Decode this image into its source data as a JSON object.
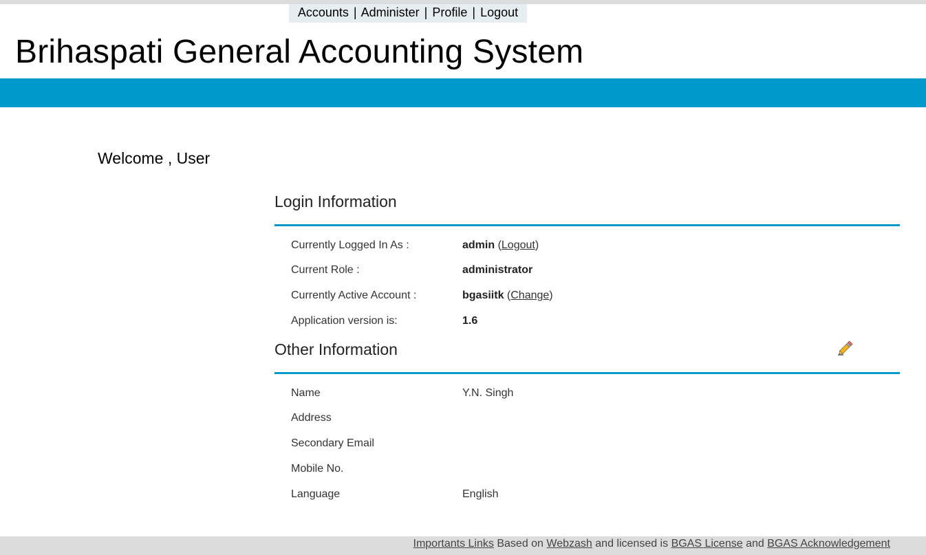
{
  "nav": {
    "items": [
      {
        "label": "Accounts"
      },
      {
        "label": "Administer"
      },
      {
        "label": "Profile"
      },
      {
        "label": "Logout"
      }
    ],
    "separator": "|"
  },
  "header": {
    "title": "Brihaspati General Accounting System",
    "bar_color": "#0099cc"
  },
  "welcome": "Welcome , User",
  "login_info": {
    "title": "Login Information",
    "logged_in_label": "Currently Logged In As :",
    "logged_in_user": "admin",
    "logout_link": "Logout",
    "role_label": "Current Role :",
    "role_value": "administrator",
    "account_label": "Currently Active Account :",
    "account_value": "bgasiitk",
    "change_link": "Change",
    "version_label": "Application version is:",
    "version_value": "1.6"
  },
  "other_info": {
    "title": "Other Information",
    "edit_icon": "pencil-icon",
    "rows": [
      {
        "label": "Name",
        "value": "Y.N. Singh"
      },
      {
        "label": "Address",
        "value": ""
      },
      {
        "label": "Secondary Email",
        "value": ""
      },
      {
        "label": "Mobile No.",
        "value": ""
      },
      {
        "label": "Language",
        "value": "English"
      }
    ]
  },
  "footer": {
    "links_label": "Importants Links",
    "based_on_text": "Based on",
    "webzash_link": "Webzash",
    "licensed_text": "and licensed is",
    "license_link": "BGAS License",
    "and_text": "and",
    "ack_link": "BGAS Acknowledgement"
  }
}
